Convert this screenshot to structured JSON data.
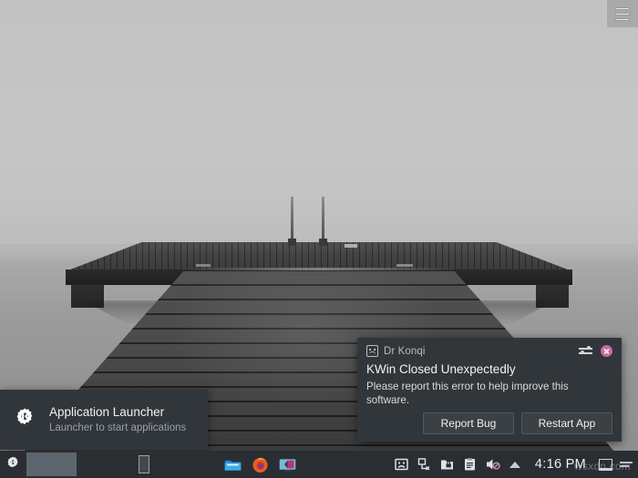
{
  "desktop": {
    "wallpaper_name": "misty-pier-wallpaper",
    "top_panel": {
      "menu_icon": "hamburger-menu-icon"
    }
  },
  "crash_dialog": {
    "title": "Dr Konqi",
    "title_icon": "sad-face-icon",
    "config_icon": "configure-sliders-icon",
    "close_icon": "close-icon",
    "heading": "KWin Closed Unexpectedly",
    "body": "Please report this error to help improve this software.",
    "buttons": [
      {
        "label": "Report Bug",
        "name": "report-bug-button"
      },
      {
        "label": "Restart App",
        "name": "restart-app-button"
      }
    ]
  },
  "launcher_tooltip": {
    "icon": "kde-launcher-icon",
    "title": "Application Launcher",
    "subtitle": "Launcher to start applications"
  },
  "panel": {
    "launcher": {
      "icon": "kde-launcher-icon",
      "label": "Application Launcher"
    },
    "tasks": [
      {
        "name": "task-button-active",
        "state": "active"
      },
      {
        "name": "task-button-1",
        "state": "inactive"
      },
      {
        "name": "task-button-2",
        "state": "inactive"
      }
    ],
    "pager": {
      "name": "pager-widget"
    },
    "launchers": [
      {
        "name": "dolphin-file-manager-icon",
        "label": "Dolphin"
      },
      {
        "name": "firefox-icon",
        "label": "Firefox"
      },
      {
        "name": "system-settings-display-icon",
        "label": "System"
      }
    ],
    "tray": [
      {
        "name": "dr-konqi-tray-icon",
        "label": "Dr Konqi"
      },
      {
        "name": "network-disconnected-icon",
        "label": "Network"
      },
      {
        "name": "vault-lock-icon",
        "label": "Plasma Vault"
      },
      {
        "name": "clipboard-icon",
        "label": "Clipboard"
      },
      {
        "name": "volume-muted-icon",
        "label": "Volume Muted"
      }
    ],
    "tray_expand": {
      "name": "show-hidden-icons-arrow",
      "label": "Show hidden icons"
    },
    "clock": "4:16 PM",
    "show_desktop": {
      "name": "show-desktop-button",
      "label": "Show Desktop"
    },
    "panel_handle": {
      "name": "panel-handle",
      "label": "Panel settings"
    }
  },
  "watermark": "wsxdn.com"
}
